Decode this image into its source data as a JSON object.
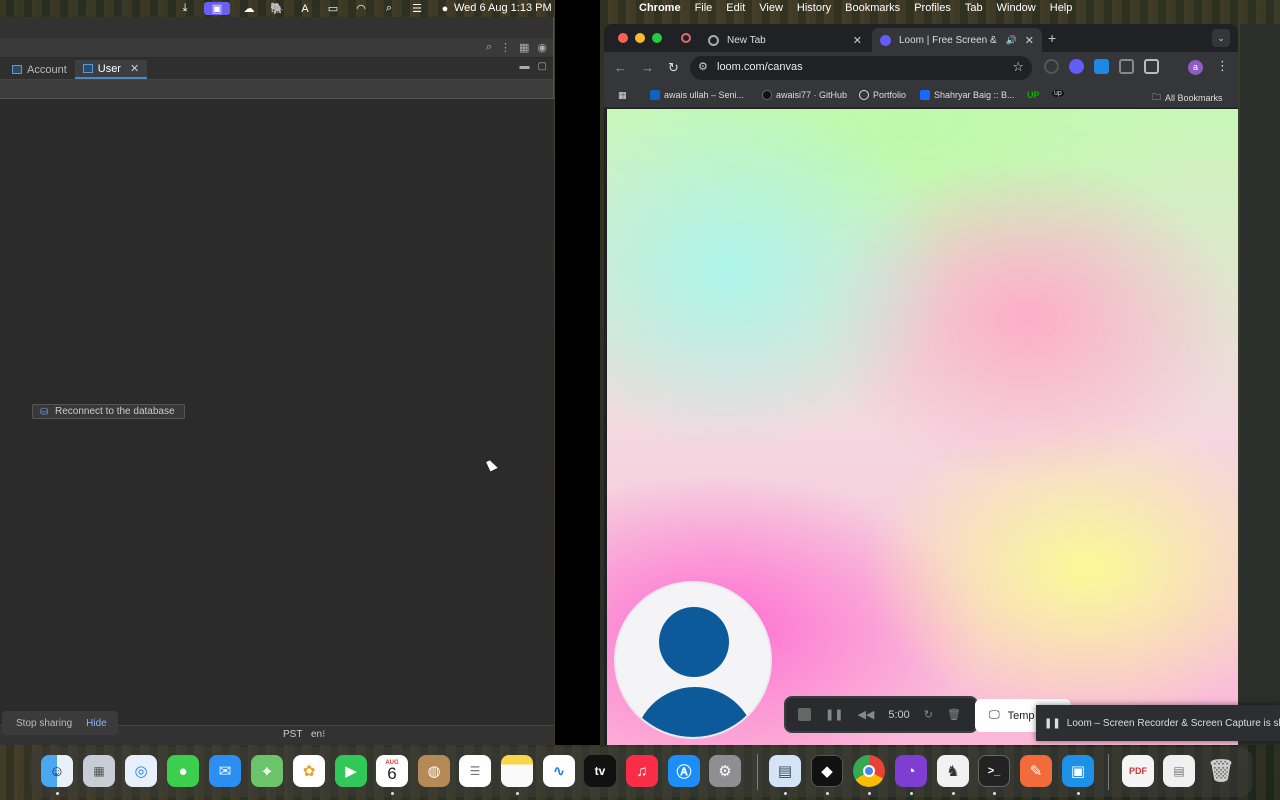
{
  "menubar": {
    "datetime": "Wed 6 Aug  1:13 PM",
    "chrome_menus": [
      "Chrome",
      "File",
      "Edit",
      "View",
      "History",
      "Bookmarks",
      "Profiles",
      "Tab",
      "Window",
      "Help"
    ],
    "status_icons": [
      "screen-share-icon",
      "cloud-icon",
      "elephant-icon",
      "keyboard-input-icon",
      "battery-icon",
      "wifi-icon",
      "spotlight-icon",
      "control-center-icon",
      "siri-icon"
    ]
  },
  "left_app": {
    "tabs": [
      {
        "label": "Account",
        "active": false
      },
      {
        "label": "User",
        "active": true,
        "close": "✕"
      }
    ],
    "reconnect_label": "Reconnect to the database",
    "status": {
      "timezone": "PST",
      "language": "en⁝"
    },
    "share_bar": {
      "stop_label": "Stop sharing",
      "hide_label": "Hide"
    }
  },
  "chrome": {
    "tabs": [
      {
        "title": "New Tab",
        "close": "✕"
      },
      {
        "title": "Loom | Free Screen & Vid",
        "close": "✕",
        "audio": "🔊"
      }
    ],
    "new_tab": "+",
    "url": "loom.com/canvas",
    "bookmarks": [
      {
        "label": "awais ullah – Seni..."
      },
      {
        "label": "awaisi77 · GitHub"
      },
      {
        "label": "Portfolio"
      },
      {
        "label": "Shahryar Baig :: B..."
      },
      {
        "label": "UP"
      },
      {
        "label": "up"
      }
    ],
    "all_bookmarks": "All Bookmarks",
    "profile_initial": "a"
  },
  "loom": {
    "timer": "5:00",
    "template_label": "Temp",
    "notice": "Loom – Screen Recorder & Screen Capture is sharing yo"
  },
  "dock": {
    "calendar_month": "AUG",
    "calendar_day": "6",
    "tv_label": "tv",
    "apps": [
      "finder-icon",
      "launchpad-icon",
      "safari-icon",
      "messages-icon",
      "mail-icon",
      "maps-icon",
      "photos-icon",
      "facetime-icon",
      "calendar-icon",
      "contacts-icon",
      "reminders-icon",
      "notes-icon",
      "freeform-icon",
      "apple-tv-icon",
      "music-icon",
      "app-store-icon",
      "system-settings-icon",
      "preview-icon",
      "unity-icon",
      "chrome-icon",
      "github-desktop-icon",
      "eclipse-icon",
      "terminal-icon",
      "postman-icon",
      "docker-icon",
      "pdf-doc-icon",
      "document-icon",
      "trash-icon"
    ]
  },
  "colors": {
    "accent_blue": "#4a88c7",
    "loom_avatar": "#0d5a9b",
    "menubar_highlight": "#6b5ff0"
  }
}
